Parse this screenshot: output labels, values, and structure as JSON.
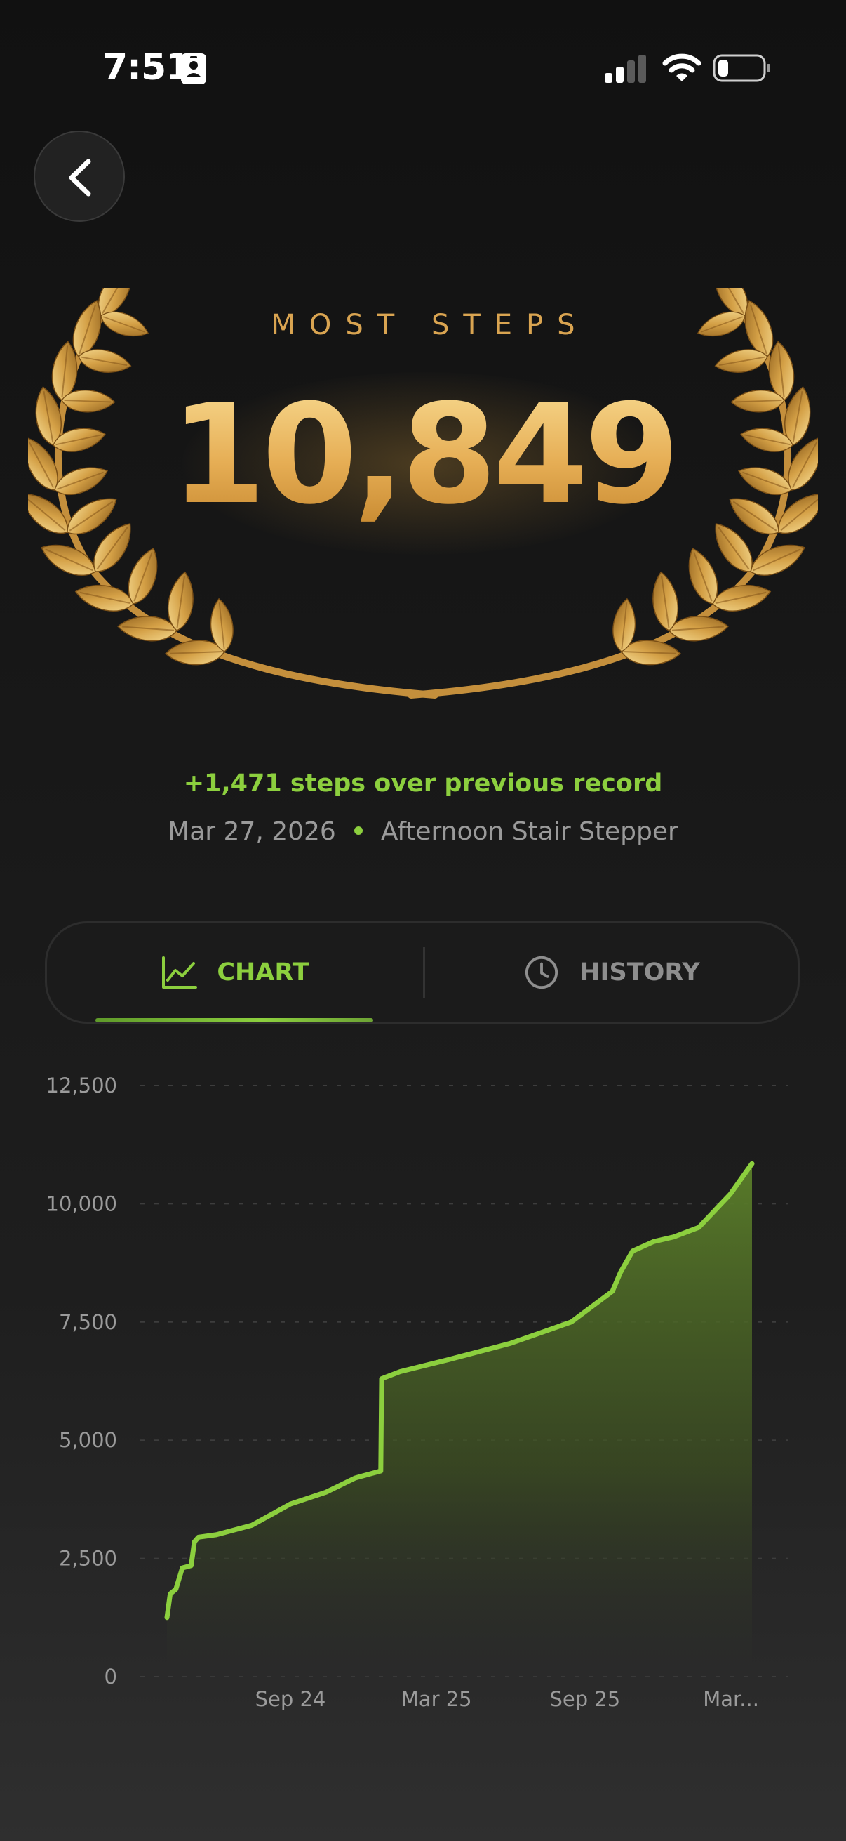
{
  "status_bar": {
    "time": "7:51"
  },
  "header": {
    "back_icon": "chevron-left-icon"
  },
  "hero": {
    "label": "MOST STEPS",
    "value": "10,849",
    "improvement": "+1,471 steps over previous record",
    "date": "Mar 27, 2026",
    "activity": "Afternoon Stair Stepper",
    "colors": {
      "gold": "#e6ae55",
      "accent": "#8ccf3e"
    }
  },
  "tabs": {
    "chart_label": "CHART",
    "chart_icon": "line-chart-icon",
    "history_label": "HISTORY",
    "history_icon": "clock-icon",
    "active": "chart"
  },
  "chart_data": {
    "type": "area",
    "y_ticks": [
      "0",
      "2,500",
      "5,000",
      "7,500",
      "10,000",
      "12,500"
    ],
    "y_tick_values": [
      0,
      2500,
      5000,
      7500,
      10000,
      12500
    ],
    "ylim": [
      0,
      12500
    ],
    "x_tick_labels": [
      "Sep 24",
      "Mar 25",
      "Sep 25",
      "Mar..."
    ],
    "x_tick_values": [
      "2024-09-01",
      "2025-03-01",
      "2025-09-01",
      "2026-03-01"
    ],
    "xlim": [
      "2024-04-01",
      "2026-03-27"
    ],
    "grid": "horizontal-dashed",
    "line_color": "#8ccf3e",
    "series": [
      {
        "x": [
          "2024-04-01",
          "2024-04-05",
          "2024-04-12",
          "2024-04-20",
          "2024-05-01",
          "2024-05-05",
          "2024-05-10",
          "2024-06-01",
          "2024-07-15",
          "2024-09-01",
          "2024-10-15",
          "2024-11-20",
          "2024-12-22",
          "2024-12-23",
          "2025-01-15",
          "2025-03-15",
          "2025-06-01",
          "2025-08-15",
          "2025-10-05",
          "2025-10-15",
          "2025-10-30",
          "2025-11-25",
          "2025-12-20",
          "2026-01-20",
          "2026-02-28",
          "2026-03-27"
        ],
        "y": [
          1250,
          1750,
          1850,
          2300,
          2350,
          2850,
          2950,
          3000,
          3200,
          3650,
          3900,
          4200,
          4350,
          6300,
          6450,
          6700,
          7050,
          7500,
          8150,
          8550,
          9000,
          9200,
          9300,
          9500,
          10200,
          10849
        ]
      }
    ]
  }
}
